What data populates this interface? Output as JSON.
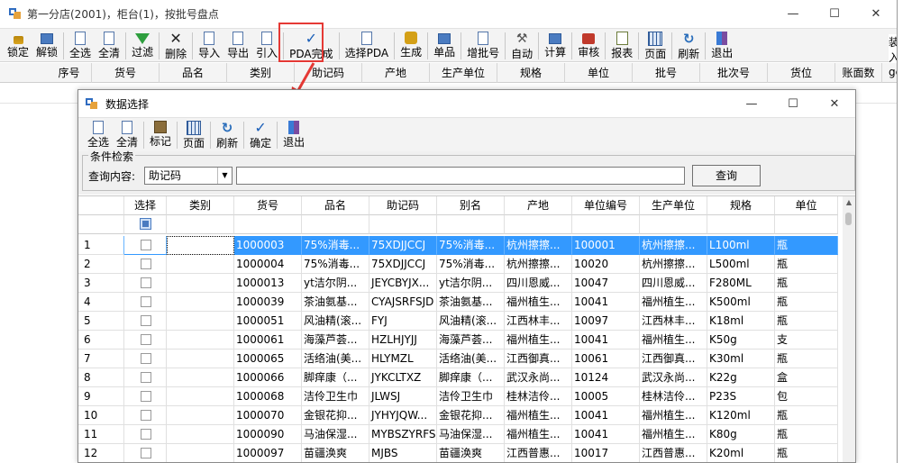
{
  "main": {
    "title": "第一分店(2001)，柜台(1)，按批号盘点",
    "toolbar": [
      {
        "id": "lock",
        "label": "锁定",
        "icon": "lock-icon"
      },
      {
        "id": "unlock",
        "label": "解锁",
        "icon": "unlock-icon"
      },
      {
        "id": "select-all",
        "label": "全选",
        "icon": "select-all-icon"
      },
      {
        "id": "clear-all",
        "label": "全清",
        "icon": "clear-all-icon"
      },
      {
        "id": "filter",
        "label": "过滤",
        "icon": "filter-icon"
      },
      {
        "id": "delete",
        "label": "删除",
        "icon": "delete-icon"
      },
      {
        "id": "import",
        "label": "导入",
        "icon": "import-icon"
      },
      {
        "id": "export",
        "label": "导出",
        "icon": "export-icon"
      },
      {
        "id": "introduce",
        "label": "引入",
        "icon": "introduce-icon"
      },
      {
        "id": "pda-done",
        "label": "PDA完成",
        "icon": "pda-check-icon"
      },
      {
        "id": "select-pda",
        "label": "选择PDA",
        "icon": "select-pda-icon"
      },
      {
        "id": "generate",
        "label": "生成",
        "icon": "generate-icon"
      },
      {
        "id": "single-item",
        "label": "单品",
        "icon": "single-item-icon"
      },
      {
        "id": "add-batch",
        "label": "增批号",
        "icon": "add-batch-icon"
      },
      {
        "id": "auto",
        "label": "自动",
        "icon": "tools-icon"
      },
      {
        "id": "calculate",
        "label": "计算",
        "icon": "calculate-icon"
      },
      {
        "id": "review",
        "label": "审核",
        "icon": "review-icon"
      },
      {
        "id": "report",
        "label": "报表",
        "icon": "report-icon"
      },
      {
        "id": "page",
        "label": "页面",
        "icon": "page-icon"
      },
      {
        "id": "refresh",
        "label": "刷新",
        "icon": "refresh-icon"
      },
      {
        "id": "exit",
        "label": "退出",
        "icon": "exit-icon"
      }
    ],
    "right_clip": "装入",
    "columns": [
      "序号",
      "货号",
      "品名",
      "类别",
      "助记码",
      "产地",
      "生产单位",
      "规格",
      "单位",
      "批号",
      "批次号",
      "货位",
      "账面数"
    ],
    "right_cut_text": "ge"
  },
  "dialog": {
    "title": "数据选择",
    "toolbar": [
      {
        "id": "select-all",
        "label": "全选",
        "icon": "select-all-icon"
      },
      {
        "id": "clear-all",
        "label": "全清",
        "icon": "clear-all-icon"
      },
      {
        "id": "mark",
        "label": "标记",
        "icon": "mark-icon"
      },
      {
        "id": "page",
        "label": "页面",
        "icon": "page-icon"
      },
      {
        "id": "refresh",
        "label": "刷新",
        "icon": "refresh-icon"
      },
      {
        "id": "confirm",
        "label": "确定",
        "icon": "confirm-check-icon"
      },
      {
        "id": "exit",
        "label": "退出",
        "icon": "exit-icon"
      }
    ],
    "search": {
      "group_label": "条件检索",
      "content_label": "查询内容:",
      "field_value": "助记码",
      "query_button": "查询"
    },
    "columns": [
      "",
      "选择",
      "类别",
      "货号",
      "品名",
      "助记码",
      "别名",
      "产地",
      "单位编号",
      "生产单位",
      "规格",
      "单位"
    ],
    "rows": [
      [
        "1",
        "",
        "",
        "1000003",
        "75%消毒...",
        "75XDJJCCJ",
        "75%消毒...",
        "杭州擦擦...",
        "100001",
        "杭州擦擦...",
        "L100ml",
        "瓶"
      ],
      [
        "2",
        "",
        "",
        "1000004",
        "75%消毒...",
        "75XDJJCCJ",
        "75%消毒...",
        "杭州擦擦...",
        "10020",
        "杭州擦擦...",
        "L500ml",
        "瓶"
      ],
      [
        "3",
        "",
        "",
        "1000013",
        "yt洁尔阴...",
        "JEYCBYJX...",
        "yt洁尔阴...",
        "四川恩威...",
        "10047",
        "四川恩威...",
        "F280ML",
        "瓶"
      ],
      [
        "4",
        "",
        "",
        "1000039",
        "茶油氨基...",
        "CYAJSRFSJD",
        "茶油氨基...",
        "福州植生...",
        "10041",
        "福州植生...",
        "K500ml",
        "瓶"
      ],
      [
        "5",
        "",
        "",
        "1000051",
        "风油精(滚...",
        "FYJ",
        "风油精(滚...",
        "江西林丰...",
        "10097",
        "江西林丰...",
        "K18ml",
        "瓶"
      ],
      [
        "6",
        "",
        "",
        "1000061",
        "海藻芦荟...",
        "HZLHJYJJ",
        "海藻芦荟...",
        "福州植生...",
        "10041",
        "福州植生...",
        "K50g",
        "支"
      ],
      [
        "7",
        "",
        "",
        "1000065",
        "活络油(美...",
        "HLYMZL",
        "活络油(美...",
        "江西御真...",
        "10061",
        "江西御真...",
        "K30ml",
        "瓶"
      ],
      [
        "8",
        "",
        "",
        "1000066",
        "脚痒康（...",
        "JYKCLTXZ",
        "脚痒康（...",
        "武汉永尚...",
        "10124",
        "武汉永尚...",
        "K22g",
        "盒"
      ],
      [
        "9",
        "",
        "",
        "1000068",
        "洁伶卫生巾",
        "JLWSJ",
        "洁伶卫生巾",
        "桂林洁伶...",
        "10005",
        "桂林洁伶...",
        "P23S",
        "包"
      ],
      [
        "10",
        "",
        "",
        "1000070",
        "金银花抑...",
        "JYHYJQW...",
        "金银花抑...",
        "福州植生...",
        "10041",
        "福州植生...",
        "K120ml",
        "瓶"
      ],
      [
        "11",
        "",
        "",
        "1000090",
        "马油保湿...",
        "MYBSZYRFS",
        "马油保湿...",
        "福州植生...",
        "10041",
        "福州植生...",
        "K80g",
        "瓶"
      ],
      [
        "12",
        "",
        "",
        "1000097",
        "苗疆涣爽",
        "MJBS",
        "苗疆涣爽",
        "江西普惠...",
        "10017",
        "江西普惠...",
        "K20ml",
        "瓶"
      ]
    ],
    "selected_row": 0
  },
  "colors": {
    "selection": "#3399ff",
    "highlight_box": "#e53935",
    "arrow": "#e53935"
  }
}
